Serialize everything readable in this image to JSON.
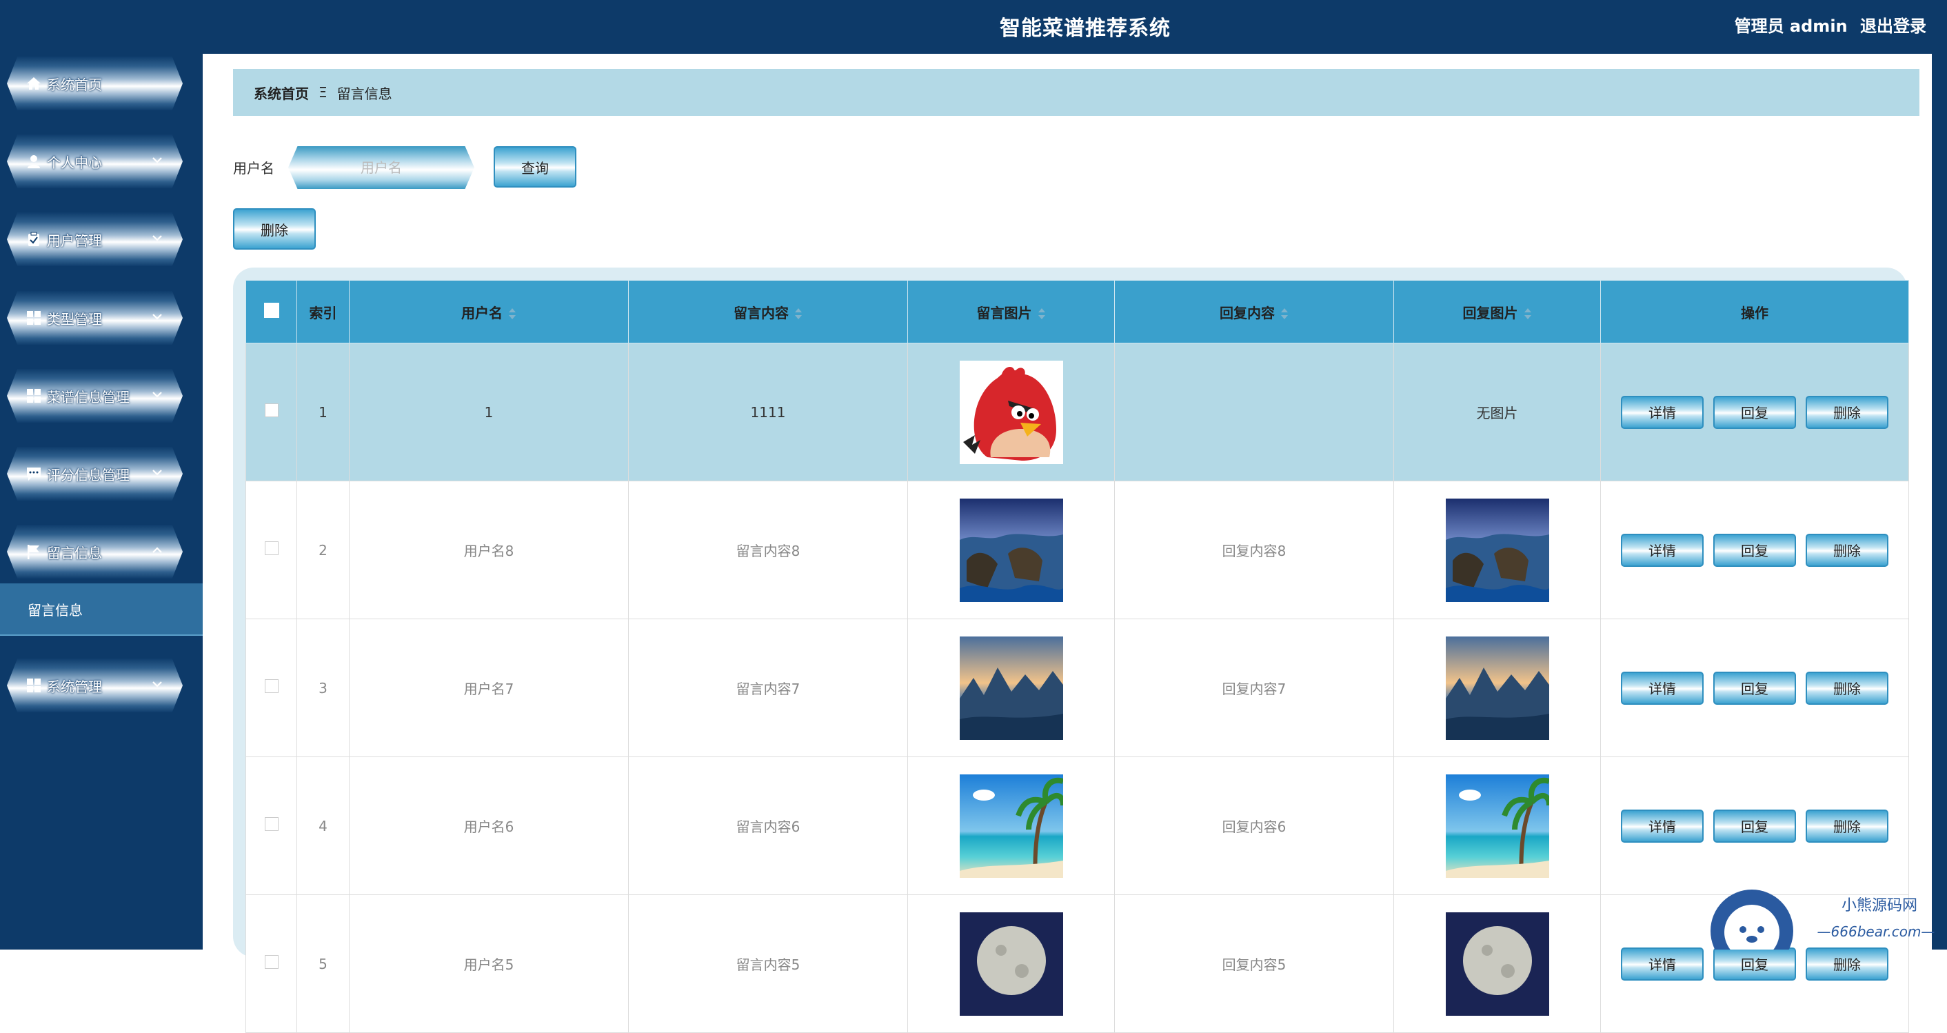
{
  "header": {
    "title": "智能菜谱推荐系统",
    "user": "管理员 admin",
    "logout": "退出登录"
  },
  "sidebar": {
    "items": [
      {
        "label": "系统首页",
        "icon": "home-icon",
        "expandable": false
      },
      {
        "label": "个人中心",
        "icon": "user-icon",
        "expandable": true
      },
      {
        "label": "用户管理",
        "icon": "clipboard-icon",
        "expandable": true
      },
      {
        "label": "类型管理",
        "icon": "grid-icon",
        "expandable": true
      },
      {
        "label": "菜谱信息管理",
        "icon": "grid-icon",
        "expandable": true
      },
      {
        "label": "评分信息管理",
        "icon": "chat-icon",
        "expandable": true
      },
      {
        "label": "留言信息",
        "icon": "flag-icon",
        "expandable": true,
        "expanded": true
      },
      {
        "label": "系统管理",
        "icon": "grid-icon",
        "expandable": true
      }
    ],
    "submenu_label": "留言信息"
  },
  "breadcrumb": {
    "home": "系统首页",
    "separator": "Ξ",
    "current": "留言信息"
  },
  "search": {
    "label": "用户名",
    "placeholder": "用户名",
    "value": "",
    "button": "查询"
  },
  "toolbar": {
    "delete_label": "删除"
  },
  "table": {
    "headers": [
      "索引",
      "用户名",
      "留言内容",
      "留言图片",
      "回复内容",
      "回复图片",
      "操作"
    ],
    "rows": [
      {
        "index": "1",
        "username": "1",
        "content": "1111",
        "image": "bird",
        "reply": "",
        "reply_image": "无图片",
        "selected": true
      },
      {
        "index": "2",
        "username": "用户名8",
        "content": "留言内容8",
        "image": "rocks",
        "reply": "回复内容8",
        "reply_image": "rocks",
        "selected": false
      },
      {
        "index": "3",
        "username": "用户名7",
        "content": "留言内容7",
        "image": "mountains",
        "reply": "回复内容7",
        "reply_image": "mountains",
        "selected": false
      },
      {
        "index": "4",
        "username": "用户名6",
        "content": "留言内容6",
        "image": "beach",
        "reply": "回复内容6",
        "reply_image": "beach",
        "selected": false
      },
      {
        "index": "5",
        "username": "用户名5",
        "content": "留言内容5",
        "image": "moon",
        "reply": "回复内容5",
        "reply_image": "moon",
        "selected": false
      }
    ],
    "actions": {
      "detail": "详情",
      "reply": "回复",
      "delete": "删除"
    }
  },
  "watermark": {
    "text1": "小熊源码网",
    "text2": "—666bear.com—"
  },
  "colors": {
    "sidebar_bg": "#0d3a69",
    "header_bg": "#0d3a69",
    "table_header": "#3aa0cc",
    "selected_row": "#b3d9e6",
    "breadcrumb_bg": "#b3d9e6"
  }
}
